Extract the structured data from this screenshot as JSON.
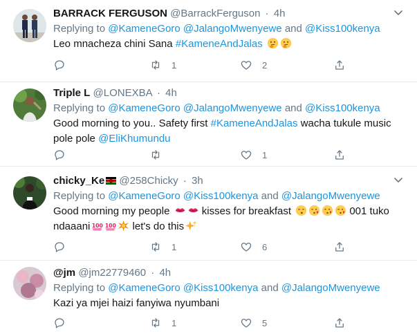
{
  "tweets": [
    {
      "name": "BARRACK FERGUSON",
      "handle": "@BarrackFerguson",
      "sep": "·",
      "time": "4h",
      "replying_prefix": "Replying to ",
      "replying_to": [
        "@KameneGoro",
        "@JalangoMwenyewe",
        "@Kiss100kenya"
      ],
      "and": " and ",
      "text_parts": [
        {
          "t": "Leo mnacheza chini Sana ",
          "link": false
        },
        {
          "t": "#KameneAndJalas",
          "link": true
        }
      ],
      "trailing_emojis": [
        "thinking-face-icon",
        "thinking-face-icon"
      ],
      "reply_count": "",
      "retweet_count": "1",
      "like_count": "2"
    },
    {
      "name": "Triple L",
      "handle": "@LONEXBA",
      "sep": "·",
      "time": "4h",
      "replying_prefix": "Replying to ",
      "replying_to": [
        "@KameneGoro",
        "@JalangoMwenyewe",
        "@Kiss100kenya"
      ],
      "and": " and ",
      "text_parts": [
        {
          "t": "Good morning to you.. Safety first ",
          "link": false
        },
        {
          "t": "#KameneAndJalas",
          "link": true
        },
        {
          "t": " wacha tukule music pole pole ",
          "link": false
        },
        {
          "t": "@EliKhumundu",
          "link": true
        }
      ],
      "reply_count": "",
      "retweet_count": "",
      "like_count": "1"
    },
    {
      "name": "chicky_Ke",
      "handle": "@258Chicky",
      "sep": "·",
      "time": "3h",
      "replying_prefix": "Replying to ",
      "replying_to": [
        "@KameneGoro",
        "@Kiss100kenya",
        "@JalangoMwenyewe"
      ],
      "and": " and ",
      "text_parts": [
        {
          "t": "Good morning my people ",
          "link": false
        },
        {
          "t": " kisses for breakfast ",
          "link": false
        },
        {
          "t": " 001 tuko ndaaani",
          "link": false
        },
        {
          "t": " let's do this",
          "link": false
        }
      ],
      "reply_count": "",
      "retweet_count": "1",
      "like_count": "6"
    },
    {
      "name": "@jm",
      "handle": "@jm22779460",
      "sep": "·",
      "time": "4h",
      "replying_prefix": "Replying to ",
      "replying_to": [
        "@KameneGoro",
        "@Kiss100kenya",
        "@JalangoMwenyewe"
      ],
      "and": " and ",
      "text_parts": [
        {
          "t": "Kazi ya mjei haizi fanyiwa nyumbani",
          "link": false
        }
      ],
      "reply_count": "",
      "retweet_count": "1",
      "like_count": "5"
    }
  ],
  "colors": {
    "link": "#1b95e0",
    "muted": "#657786",
    "text": "#14171a",
    "divider": "#e6ecf0"
  }
}
